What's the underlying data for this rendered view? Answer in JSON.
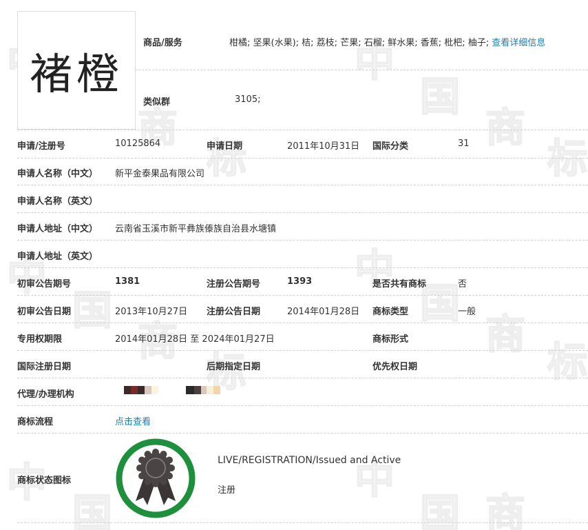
{
  "trademark": {
    "name": "褚橙"
  },
  "goods": {
    "label": "商品/服务",
    "value": "柑橘; 坚果(水果); 桔; 荔枝; 芒果; 石榴; 鲜水果; 香蕉; 枇杷; 柚子;",
    "link": "查看详细信息"
  },
  "similar_group": {
    "label": "类似群",
    "value": "3105;"
  },
  "rows": {
    "reg_no": {
      "label": "申请/注册号",
      "value": "10125864"
    },
    "apply_date": {
      "label": "申请日期",
      "value": "2011年10月31日"
    },
    "intl_class": {
      "label": "国际分类",
      "value": "31"
    },
    "applicant_cn": {
      "label": "申请人名称（中文）",
      "value": "新平金泰果品有限公司"
    },
    "applicant_en": {
      "label": "申请人名称（英文）",
      "value": ""
    },
    "address_cn": {
      "label": "申请人地址（中文）",
      "value": "云南省玉溪市新平彝族傣族自治县水塘镇"
    },
    "address_en": {
      "label": "申请人地址（英文）",
      "value": ""
    },
    "prelim_issue_no": {
      "label": "初审公告期号",
      "value": "1381"
    },
    "reg_issue_no": {
      "label": "注册公告期号",
      "value": "1393"
    },
    "shared": {
      "label": "是否共有商标",
      "value": "否"
    },
    "prelim_date": {
      "label": "初审公告日期",
      "value": "2013年10月27日"
    },
    "reg_date": {
      "label": "注册公告日期",
      "value": "2014年01月28日"
    },
    "tm_type": {
      "label": "商标类型",
      "value": "一般"
    },
    "exclusive_period": {
      "label": "专用权期限",
      "value": "2014年01月28日 至 2024年01月27日"
    },
    "tm_form": {
      "label": "商标形式",
      "value": ""
    },
    "intl_reg_date": {
      "label": "国际注册日期",
      "value": ""
    },
    "later_designation": {
      "label": "后期指定日期",
      "value": ""
    },
    "priority_date": {
      "label": "优先权日期",
      "value": ""
    },
    "agent": {
      "label": "代理/办理机构",
      "value": ""
    },
    "process": {
      "label": "商标流程",
      "link": "点击查看"
    },
    "status_icon": {
      "label": "商标状态图标"
    }
  },
  "status": {
    "en": "LIVE/REGISTRATION/Issued and Active",
    "cn": "注册"
  },
  "colors": {
    "seal_ring": "#1e8f3c",
    "seal_body": "#4a4444",
    "link": "#1c7fb4",
    "divider": "#d0d0d0"
  },
  "watermark": {
    "chars": [
      "中",
      "国",
      "商",
      "标"
    ]
  }
}
